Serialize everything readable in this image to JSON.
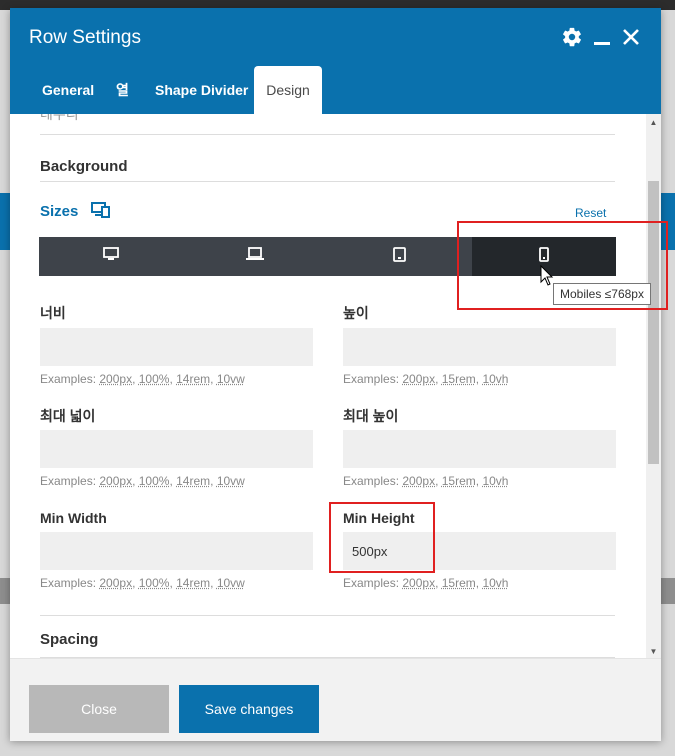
{
  "window": {
    "title": "Row Settings"
  },
  "tabs": [
    {
      "label": "General"
    },
    {
      "label": "열"
    },
    {
      "label": "Shape Divider"
    },
    {
      "label": "Design"
    }
  ],
  "sections": {
    "partial_top": "테두리",
    "background": "Background",
    "spacing": "Spacing"
  },
  "sizes": {
    "title": "Sizes",
    "reset": "Reset",
    "tooltip": "Mobiles ≤768px"
  },
  "fields": [
    {
      "label": "너비",
      "value": "",
      "examples": "Examples:",
      "opts": [
        "200px",
        "100%",
        "14rem",
        "10vw"
      ]
    },
    {
      "label": "높이",
      "value": "",
      "examples": "Examples:",
      "opts": [
        "200px",
        "15rem",
        "10vh"
      ]
    },
    {
      "label": "최대 넓이",
      "value": "",
      "examples": "Examples:",
      "opts": [
        "200px",
        "100%",
        "14rem",
        "10vw"
      ]
    },
    {
      "label": "최대 높이",
      "value": "",
      "examples": "Examples:",
      "opts": [
        "200px",
        "15rem",
        "10vh"
      ]
    },
    {
      "label": "Min Width",
      "value": "",
      "examples": "Examples:",
      "opts": [
        "200px",
        "100%",
        "14rem",
        "10vw"
      ]
    },
    {
      "label": "Min Height",
      "value": "500px",
      "examples": "Examples:",
      "opts": [
        "200px",
        "15rem",
        "10vh"
      ]
    }
  ],
  "footer": {
    "close": "Close",
    "save": "Save changes"
  },
  "colors": {
    "accent": "#0a71ad",
    "highlight": "#e02020"
  }
}
